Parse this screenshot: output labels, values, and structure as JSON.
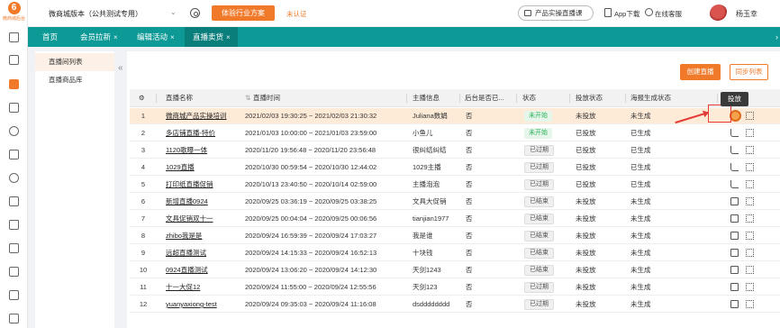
{
  "brand": {
    "logo_text": "微商城后台",
    "accent": "#f07a2a",
    "teal": "#0d9a96"
  },
  "header": {
    "store_name": "微商城版本（公共测试专用）",
    "trial_button": "体验行业方案",
    "unauth": "未认证",
    "demo_button": "产品实操直播课",
    "app_download": "App下载",
    "online_service": "在线客服",
    "username": "杨玉幸"
  },
  "tabs": [
    {
      "label": "首页",
      "closable": false
    },
    {
      "label": "会员拉新",
      "closable": true
    },
    {
      "label": "编辑活动",
      "closable": true
    },
    {
      "label": "直播卖货",
      "closable": true
    }
  ],
  "subnav": {
    "items": [
      "直播间列表",
      "直播商品库"
    ]
  },
  "toolbar": {
    "create": "创建直播",
    "sync": "同步列表"
  },
  "tooltip": "投放",
  "table": {
    "headers": [
      "直播名称",
      "直播时间",
      "主播信息",
      "后台是否已...",
      "状态",
      "投放状态",
      "海报生成状态",
      "操作"
    ],
    "rows": [
      {
        "no": "1",
        "name": "微商城产品实操培训",
        "time": "2021/02/03 19:30:25 ~ 2021/02/03 21:30:32",
        "anchor": "Juliana数娟",
        "backend": "否",
        "status": "未开始",
        "status_color": "green",
        "put": "未投放",
        "poster": "未生成",
        "action": "live"
      },
      {
        "no": "2",
        "name": "多店铺直播-特价",
        "time": "2021/01/03 10:00:00 ~ 2021/01/03 23:59:00",
        "anchor": "小鱼儿",
        "backend": "否",
        "status": "未开始",
        "status_color": "green",
        "put": "已投放",
        "poster": "已生成",
        "action": "reply"
      },
      {
        "no": "3",
        "name": "1120歌曝一体",
        "time": "2020/11/20 19:56:48 ~ 2020/11/20 23:56:48",
        "anchor": "很纠结纠结",
        "backend": "否",
        "status": "已过期",
        "status_color": "grey",
        "put": "已投放",
        "poster": "已生成",
        "action": "reply"
      },
      {
        "no": "4",
        "name": "1029直播",
        "time": "2020/10/30 00:59:54 ~ 2020/10/30 12:44:02",
        "anchor": "1029主播",
        "backend": "否",
        "status": "已过期",
        "status_color": "grey",
        "put": "已投放",
        "poster": "已生成",
        "action": "reply"
      },
      {
        "no": "5",
        "name": "打印纸直播促销",
        "time": "2020/10/13 23:40:50 ~ 2020/10/14 02:59:00",
        "anchor": "主播泡泡",
        "backend": "否",
        "status": "已过期",
        "status_color": "grey",
        "put": "已投放",
        "poster": "已生成",
        "action": "reply"
      },
      {
        "no": "6",
        "name": "新增直播0924",
        "time": "2020/09/25 03:36:19 ~ 2020/09/25 03:38:25",
        "anchor": "文具大促销",
        "backend": "否",
        "status": "已结束",
        "status_color": "grey",
        "put": "未投放",
        "poster": "未生成",
        "action": "share"
      },
      {
        "no": "7",
        "name": "文具促销双十一",
        "time": "2020/09/25 00:04:04 ~ 2020/09/25 00:06:56",
        "anchor": "tianjian1977",
        "backend": "否",
        "status": "已结束",
        "status_color": "grey",
        "put": "未投放",
        "poster": "未生成",
        "action": "share"
      },
      {
        "no": "8",
        "name": "zhibo我是是",
        "time": "2020/09/24 16:59:39 ~ 2020/09/24 17:03:27",
        "anchor": "我是谁",
        "backend": "否",
        "status": "已结束",
        "status_color": "grey",
        "put": "未投放",
        "poster": "未生成",
        "action": "share"
      },
      {
        "no": "9",
        "name": "远超直播测试",
        "time": "2020/09/24 14:15:33 ~ 2020/09/24 16:52:13",
        "anchor": "十块钱",
        "backend": "否",
        "status": "已结束",
        "status_color": "grey",
        "put": "未投放",
        "poster": "未生成",
        "action": "share"
      },
      {
        "no": "10",
        "name": "0924直播测试",
        "time": "2020/09/24 13:06:20 ~ 2020/09/24 14:12:30",
        "anchor": "天剑1243",
        "backend": "否",
        "status": "已结束",
        "status_color": "grey",
        "put": "未投放",
        "poster": "未生成",
        "action": "share"
      },
      {
        "no": "11",
        "name": "十一大促12",
        "time": "2020/09/24 11:55:00 ~ 2020/09/24 12:55:56",
        "anchor": "天剑123",
        "backend": "否",
        "status": "已过期",
        "status_color": "grey",
        "put": "未投放",
        "poster": "未生成",
        "action": "share"
      },
      {
        "no": "12",
        "name": "yuanyaxiong-test",
        "time": "2020/09/24 09:35:03 ~ 2020/09/24 11:16:08",
        "anchor": "dsdddddddd",
        "backend": "否",
        "status": "已过期",
        "status_color": "grey",
        "put": "未投放",
        "poster": "未生成",
        "action": "share"
      }
    ]
  }
}
